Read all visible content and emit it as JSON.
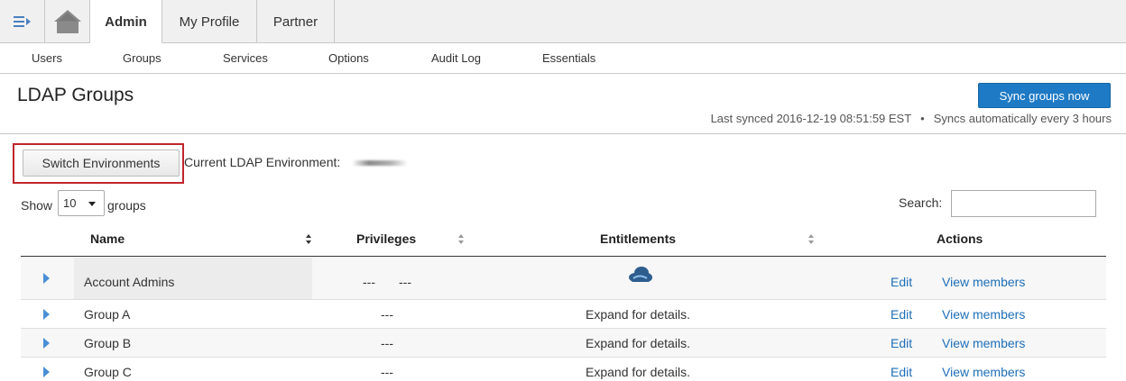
{
  "top_tabs": [
    {
      "label": "Admin",
      "active": true
    },
    {
      "label": "My Profile",
      "active": false
    },
    {
      "label": "Partner",
      "active": false
    }
  ],
  "subnav": [
    "Users",
    "Groups",
    "Services",
    "Options",
    "Audit Log",
    "Essentials"
  ],
  "page": {
    "title": "LDAP Groups",
    "sync_button": "Sync groups now",
    "last_synced": "Last synced 2016-12-19 08:51:59 EST",
    "sync_separator": "•",
    "sync_schedule": "Syncs automatically every 3 hours"
  },
  "environment": {
    "switch_button": "Switch Environments",
    "current_label": "Current LDAP Environment:"
  },
  "controls": {
    "show_label": "Show",
    "page_size": "10",
    "groups_label": "groups",
    "search_label": "Search:"
  },
  "table": {
    "columns": [
      "Name",
      "Privileges",
      "Entitlements",
      "Actions"
    ],
    "rows": [
      {
        "name": "Account Admins",
        "privileges": "---",
        "privileges_2": "---",
        "entitlements": "",
        "entitlement_icon": "cloud-icon",
        "edit": "Edit",
        "view": "View members"
      },
      {
        "name": "Group A",
        "privileges": "---",
        "entitlements": "Expand for details.",
        "edit": "Edit",
        "view": "View members"
      },
      {
        "name": "Group B",
        "privileges": "---",
        "entitlements": "Expand for details.",
        "edit": "Edit",
        "view": "View members"
      },
      {
        "name": "Group C",
        "privileges": "---",
        "entitlements": "Expand for details.",
        "edit": "Edit",
        "view": "View members"
      }
    ]
  },
  "colors": {
    "primary_button": "#1e7ac4",
    "link": "#1e6fb8",
    "highlight": "#c0262c",
    "expander": "#4a8fd6"
  }
}
